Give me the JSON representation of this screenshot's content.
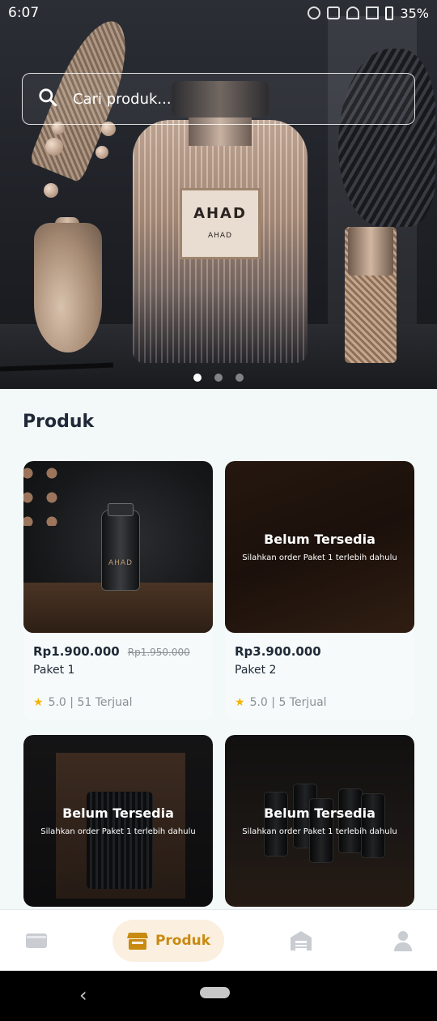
{
  "statusbar": {
    "time": "6:07",
    "battery": "35%"
  },
  "search": {
    "placeholder": "Cari produk..."
  },
  "banner": {
    "label_brand": "AHAD",
    "label_sub": "AHAD",
    "slides": 3,
    "active_slide": 1
  },
  "section": {
    "title": "Produk"
  },
  "products": [
    {
      "name": "Paket 1",
      "price": "Rp1.900.000",
      "old_price": "Rp1.950.000",
      "rating": "5.0 | 51 Terjual",
      "available": true,
      "jar_label": "AHAD"
    },
    {
      "name": "Paket 2",
      "price": "Rp3.900.000",
      "rating": "5.0 | 5 Terjual",
      "available": false,
      "unavailable_title": "Belum Tersedia",
      "unavailable_sub": "Silahkan order Paket 1 terlebih dahulu"
    },
    {
      "available": false,
      "unavailable_title": "Belum Tersedia",
      "unavailable_sub": "Silahkan order Paket 1 terlebih dahulu"
    },
    {
      "available": false,
      "unavailable_title": "Belum Tersedia",
      "unavailable_sub": "Silahkan order Paket 1 terlebih dahulu"
    }
  ],
  "bottom_nav": {
    "items": [
      {
        "icon": "wallet-icon"
      },
      {
        "icon": "store-icon",
        "label": "Produk",
        "active": true
      },
      {
        "icon": "warehouse-icon"
      },
      {
        "icon": "profile-icon"
      }
    ],
    "accent": "#c98a12"
  },
  "colors": {
    "background": "#f3f8f8",
    "accent": "#c98a12",
    "active_nav_bg": "#fbf0df",
    "star": "#f5b400"
  }
}
